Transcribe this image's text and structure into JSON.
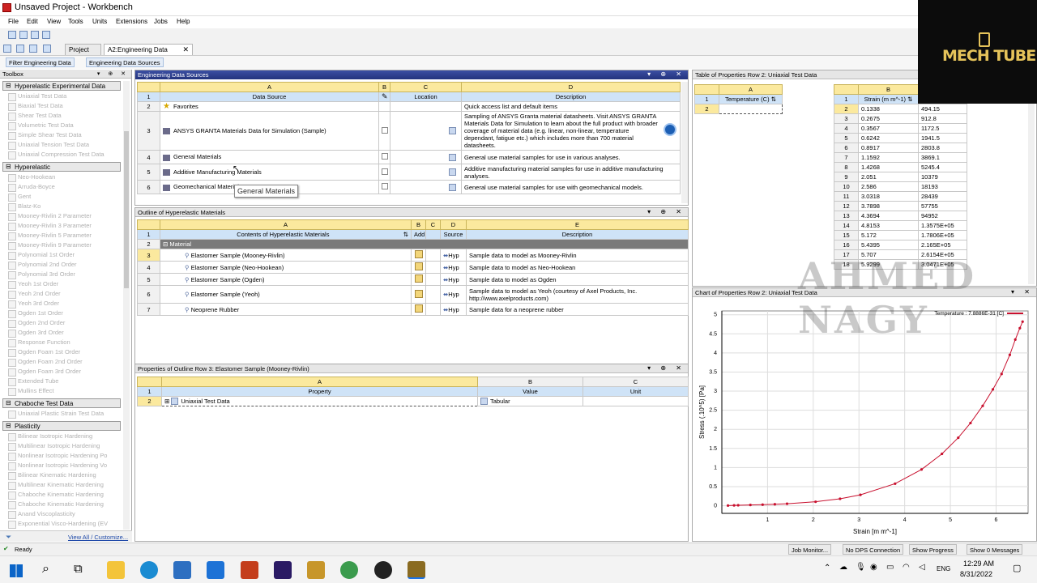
{
  "window": {
    "title": "Unsaved Project - Workbench"
  },
  "menu": [
    "File",
    "Edit",
    "View",
    "Tools",
    "Units",
    "Extensions",
    "Jobs",
    "Help"
  ],
  "tabs": [
    {
      "label": "Project"
    },
    {
      "label": "A2:Engineering Data"
    }
  ],
  "toolbar2": {
    "filter": "Filter Engineering Data",
    "sources": "Engineering Data Sources"
  },
  "toolbox": {
    "title": "Toolbox",
    "group0": "Hyperelastic Experimental Data",
    "group0_items": [
      "Uniaxial Test Data",
      "Biaxial Test Data",
      "Shear Test Data",
      "Volumetric Test Data",
      "Simple Shear Test Data",
      "Uniaxial Tension Test Data",
      "Uniaxial Compression Test Data"
    ],
    "group1": "Hyperelastic",
    "group1_items": [
      "Neo-Hookean",
      "Arruda-Boyce",
      "Gent",
      "Blatz-Ko",
      "Mooney-Rivlin 2 Parameter",
      "Mooney-Rivlin 3 Parameter",
      "Mooney-Rivlin 5 Parameter",
      "Mooney-Rivlin 9 Parameter",
      "Polynomial 1st Order",
      "Polynomial 2nd Order",
      "Polynomial 3rd Order",
      "Yeoh 1st Order",
      "Yeoh 2nd Order",
      "Yeoh 3rd Order",
      "Ogden 1st Order",
      "Ogden 2nd Order",
      "Ogden 3rd Order",
      "Response Function",
      "Ogden Foam 1st Order",
      "Ogden Foam 2nd Order",
      "Ogden Foam 3rd Order",
      "Extended Tube",
      "Mullins Effect"
    ],
    "group2": "Chaboche Test Data",
    "group2_items": [
      "Uniaxial Plastic Strain Test Data"
    ],
    "group3": "Plasticity",
    "group3_items": [
      "Bilinear Isotropic Hardening",
      "Multilinear Isotropic Hardening",
      "Nonlinear Isotropic Hardening Po",
      "Nonlinear Isotropic Hardening Vo",
      "Bilinear Kinematic Hardening",
      "Multilinear Kinematic Hardening",
      "Chaboche Kinematic Hardening",
      "Chaboche Kinematic Hardening",
      "Anand Viscoplasticity",
      "Exponential Visco-Hardening (EV"
    ],
    "view_all": "View All / Customize..."
  },
  "sources": {
    "title": "Engineering Data Sources",
    "cols": [
      "A",
      "B",
      "C",
      "D"
    ],
    "labels": [
      "Data Source",
      "",
      "Location",
      "Description"
    ],
    "rows": [
      {
        "n": "2",
        "name": "Favorites",
        "desc": "Quick access list and default items"
      },
      {
        "n": "3",
        "name": "ANSYS GRANTA Materials Data for Simulation (Sample)",
        "desc": "Sampling of ANSYS Granta material datasheets. Visit ANSYS GRANTA Materials Data for Simulation to learn about the full product with broader coverage of material data (e.g. linear, non-linear, temperature dependant, fatigue etc.) which includes more than 700 material datasheets."
      },
      {
        "n": "4",
        "name": "General Materials",
        "desc": "General use material samples for use in various analyses."
      },
      {
        "n": "5",
        "name": "Additive Manufacturing Materials",
        "desc": "Additive manufacturing material samples for use in additive manufacturing analyses."
      },
      {
        "n": "6",
        "name": "Geomechanical Materials",
        "desc": "General use material samples for use with geomechanical models."
      }
    ],
    "tooltip": "General Materials"
  },
  "outline": {
    "title": "Outline of Hyperelastic Materials",
    "cols": [
      "A",
      "B",
      "C",
      "D",
      "E"
    ],
    "labels": [
      "Contents of Hyperelastic Materials",
      "Add",
      "",
      "Source",
      "Description"
    ],
    "section": "Material",
    "rows": [
      {
        "n": "3",
        "name": "Elastomer Sample (Mooney-Rivlin)",
        "src": "Hyp",
        "desc": "Sample data to model as Mooney-Rivlin"
      },
      {
        "n": "4",
        "name": "Elastomer Sample (Neo-Hookean)",
        "src": "Hyp",
        "desc": "Sample data to model as Neo-Hookean"
      },
      {
        "n": "5",
        "name": "Elastomer Sample (Ogden)",
        "src": "Hyp",
        "desc": "Sample data to model as Ogden"
      },
      {
        "n": "6",
        "name": "Elastomer Sample (Yeoh)",
        "src": "Hyp",
        "desc": "Sample data to model as Yeoh (courtesy of Axel Products, Inc. http://www.axelproducts.com)"
      },
      {
        "n": "7",
        "name": "Neoprene Rubber",
        "src": "Hyp",
        "desc": "Sample data for a neoprene rubber"
      }
    ]
  },
  "props": {
    "title": "Properties of Outline Row 3: Elastomer Sample (Mooney-Rivlin)",
    "cols": [
      "A",
      "B",
      "C"
    ],
    "labels": [
      "Property",
      "Value",
      "Unit"
    ],
    "row": {
      "n": "2",
      "name": "Uniaxial Test Data",
      "value": "Tabular"
    }
  },
  "table": {
    "title": "Table of Properties Row 2: Uniaxial Test Data",
    "colA": "A",
    "labelA": "Temperature (C)",
    "colB": "B",
    "labelB": "Strain (m m^-1)",
    "rows": [
      [
        "2",
        "0.1338",
        "494.15"
      ],
      [
        "3",
        "0.2675",
        "912.8"
      ],
      [
        "4",
        "0.3567",
        "1172.5"
      ],
      [
        "5",
        "0.6242",
        "1941.5"
      ],
      [
        "6",
        "0.8917",
        "2803.8"
      ],
      [
        "7",
        "1.1592",
        "3869.1"
      ],
      [
        "8",
        "1.4268",
        "5245.4"
      ],
      [
        "9",
        "2.051",
        "10379"
      ],
      [
        "10",
        "2.586",
        "18193"
      ],
      [
        "11",
        "3.0318",
        "28439"
      ],
      [
        "12",
        "3.7898",
        "57755"
      ],
      [
        "13",
        "4.3694",
        "94952"
      ],
      [
        "14",
        "4.8153",
        "1.3575E+05"
      ],
      [
        "15",
        "5.172",
        "1.7806E+05"
      ],
      [
        "16",
        "5.4395",
        "2.165E+05"
      ],
      [
        "17",
        "5.707",
        "2.6154E+05"
      ],
      [
        "18",
        "5.9299",
        "3.0471E+05"
      ]
    ]
  },
  "chart": {
    "title": "Chart of Properties Row 2: Uniaxial Test Data"
  },
  "chart_data": {
    "type": "line",
    "title": "",
    "xlabel": "Strain  [m m^-1]",
    "ylabel": "Stress  (.10^5)  [Pa]",
    "legend": "Temperature : 7.8886E-31 [C]",
    "xlim": [
      0,
      6.7
    ],
    "ylim": [
      -0.2,
      5.1
    ],
    "xticks": [
      "1",
      "2",
      "3",
      "4",
      "5",
      "6"
    ],
    "yticks": [
      "0",
      "0.5",
      "1",
      "1.5",
      "2",
      "2.5",
      "3",
      "3.5",
      "4",
      "4.5",
      "5"
    ],
    "x": [
      0.1338,
      0.2675,
      0.3567,
      0.6242,
      0.8917,
      1.1592,
      1.4268,
      2.051,
      2.586,
      3.0318,
      3.7898,
      4.3694,
      4.8153,
      5.172,
      5.4395,
      5.707,
      5.9299,
      6.12,
      6.3,
      6.42,
      6.52,
      6.58
    ],
    "y": [
      0.0049,
      0.0091,
      0.0117,
      0.0194,
      0.028,
      0.0387,
      0.0525,
      0.1038,
      0.1819,
      0.2844,
      0.5776,
      0.9495,
      1.3575,
      1.7806,
      2.165,
      2.6154,
      3.0471,
      3.45,
      3.95,
      4.35,
      4.65,
      4.82
    ],
    "color": "#c8102e"
  },
  "status": {
    "ready": "Ready",
    "job": "Job Monitor...",
    "dps": "No DPS Connection",
    "progress": "Show Progress",
    "messages": "Show 0 Messages"
  },
  "taskbar": {
    "lang": "ENG",
    "time": "12:29 AM",
    "date": "8/31/2022"
  },
  "watermark": {
    "logo": "MECH TUBE",
    "signature": "AHMED NAGY"
  }
}
